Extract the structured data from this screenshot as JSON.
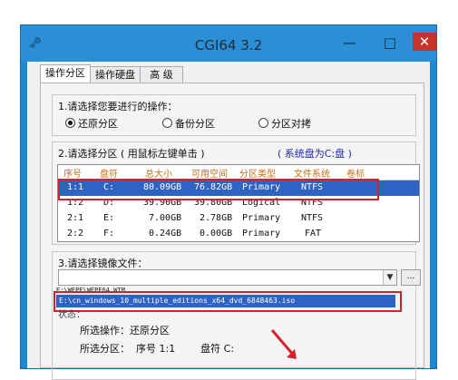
{
  "window": {
    "title": "CGI64  3.2",
    "min": "—",
    "max": "□",
    "close": "✕",
    "icon": "🗝"
  },
  "tabs": [
    {
      "label": "操作分区",
      "active": true
    },
    {
      "label": "操作硬盘",
      "active": false
    },
    {
      "label": "高  级",
      "active": false
    }
  ],
  "step1": {
    "label": "1.请选择您要进行的操作：",
    "options": [
      {
        "label": "还原分区",
        "checked": true
      },
      {
        "label": "备份分区",
        "checked": false
      },
      {
        "label": "分区对拷",
        "checked": false
      }
    ]
  },
  "step2": {
    "label": "2.请选择分区 ( 用鼠标左键单击 )",
    "sysdisk": "( 系统盘为C:盘 )",
    "columns": [
      "序号",
      "盘符",
      "总大小",
      "可用空间",
      "分区类型",
      "文件系统",
      "卷标"
    ],
    "rows": [
      {
        "no": "1:1",
        "drive": "C:",
        "total": "80.09GB",
        "free": "76.82GB",
        "type": "Primary",
        "fs": "NTFS",
        "label": "",
        "selected": true
      },
      {
        "no": "1:2",
        "drive": "D:",
        "total": "39.90GB",
        "free": "39.80GB",
        "type": "Logical",
        "fs": "NTFS",
        "label": "",
        "selected": false
      },
      {
        "no": "2:1",
        "drive": "E:",
        "total": "7.00GB",
        "free": "2.78GB",
        "type": "Primary",
        "fs": "NTFS",
        "label": "",
        "selected": false
      },
      {
        "no": "2:2",
        "drive": "F:",
        "total": "0.24GB",
        "free": "0.00GB",
        "type": "Primary",
        "fs": "FAT",
        "label": "",
        "selected": false
      }
    ]
  },
  "step3": {
    "label": "3.请选择镜像文件：",
    "browse": "...",
    "dropdown_icon": "chevron-down",
    "recent": "E:\\WEPE\\WEPE64.WIM",
    "selected_iso": "E:\\cn_windows_10_multiple_editions_x64_dvd_6848463.iso"
  },
  "status": {
    "label": "状态：",
    "op_line": "所选操作：还原分区",
    "part_line": "所选分区：  序号 1:1        盘符 C:"
  },
  "colors": {
    "window_frame": "#1e87cf",
    "selection": "#2f63c3",
    "highlight_box": "#d4222a",
    "header_text": "#c07020",
    "sysdisk_text": "#1f28c0"
  }
}
